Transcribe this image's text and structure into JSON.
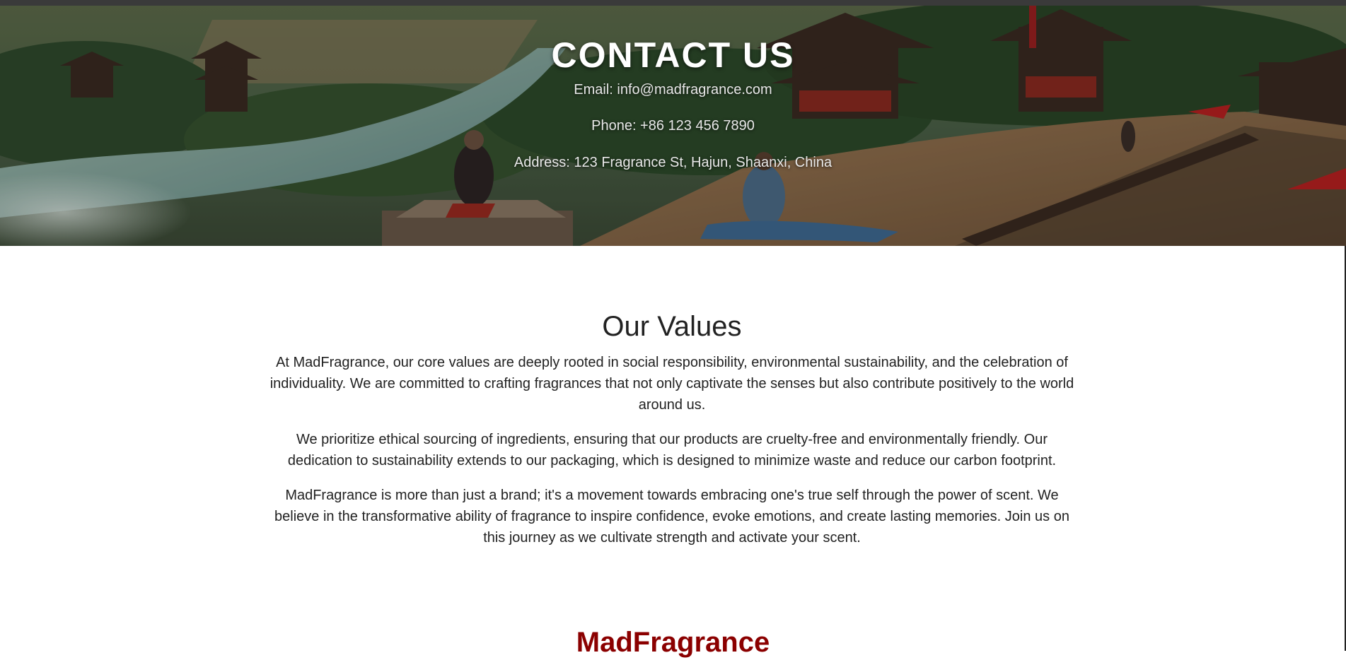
{
  "hero": {
    "title": "CONTACT US",
    "email": "Email: info@madfragrance.com",
    "phone": "Phone: +86 123 456 7890",
    "address": "Address: 123 Fragrance St, Hajun, Shaanxi, China"
  },
  "values": {
    "heading": "Our Values",
    "paragraphs": [
      "At MadFragrance, our core values are deeply rooted in social responsibility, environmental sustainability, and the celebration of individuality. We are committed to crafting fragrances that not only captivate the senses but also contribute positively to the world around us.",
      "We prioritize ethical sourcing of ingredients, ensuring that our products are cruelty-free and environmentally friendly. Our dedication to sustainability extends to our packaging, which is designed to minimize waste and reduce our carbon footprint.",
      "MadFragrance is more than just a brand; it's a movement towards embracing one's true self through the power of scent. We believe in the transformative ability of fragrance to inspire confidence, evoke emotions, and create lasting memories. Join us on this journey as we cultivate strength and activate your scent."
    ]
  },
  "footer": {
    "brand": "MadFragrance"
  },
  "colors": {
    "brand_red": "#8b0000",
    "text": "#222222",
    "hero_text": "#ffffff"
  }
}
